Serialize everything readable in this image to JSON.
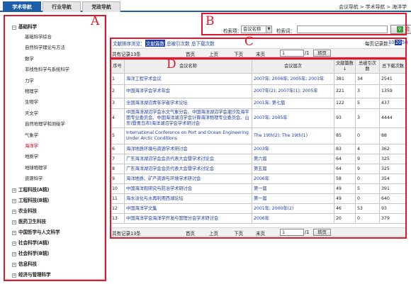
{
  "tabs": [
    "学术导航",
    "行业导航",
    "党政导航"
  ],
  "breadcrumb": "会议导航 > 学术导航 > 海洋学",
  "sidebar": {
    "categories": [
      {
        "label": "基础科学",
        "expanded": true,
        "children": [
          "基础科学综合",
          "自然科学理论与方法",
          "数学",
          "非线性科学与系统科学",
          "力学",
          "物理学",
          "生物学",
          "天文学",
          "自然地理学和测绘学",
          "气象学",
          "海洋学",
          "地质学",
          "地球物理学",
          "资源科学"
        ]
      },
      {
        "label": "工程科技(A辑)",
        "expanded": false
      },
      {
        "label": "工程科技(B辑)",
        "expanded": false
      },
      {
        "label": "农业科技",
        "expanded": false
      },
      {
        "label": "医药卫生科技",
        "expanded": false
      },
      {
        "label": "中国哲学与人文科学",
        "expanded": false
      },
      {
        "label": "社会科学(A辑)",
        "expanded": false
      },
      {
        "label": "社会科学(B辑)",
        "expanded": false
      },
      {
        "label": "信息科技",
        "expanded": false
      },
      {
        "label": "经济与管理科学",
        "expanded": false
      }
    ],
    "selected": "海洋学",
    "expand_glyph": "+",
    "collapse_glyph": "−"
  },
  "search": {
    "field_label": "检索项：",
    "field_value": "会议名称",
    "field_arrow": "▼",
    "word_label": "检索词：",
    "word_value": "",
    "button_label": "检 索",
    "button_icon": "magnifier-icon"
  },
  "order": {
    "label": "文献排序浏览：",
    "options": [
      "文献篇数",
      "总被引次数",
      "总下载次数"
    ],
    "active": 0,
    "per_page_label": "每页记录数：",
    "per_page_options": [
      "10",
      "20",
      "50"
    ],
    "per_page_active": 1
  },
  "pager": {
    "total": "共有记录13条",
    "first": "首页",
    "prev": "上页",
    "next": "下页",
    "last": "末页",
    "page_value": "1",
    "page_unit": "/1",
    "go": "转页"
  },
  "table": {
    "headers": [
      "序号",
      "会议名称",
      "会议届次",
      "文献篇数↓",
      "总被引次数",
      "总下载次数"
    ],
    "rows": [
      [
        "1",
        "海洋工程学术会议",
        "2007年; 2006年; 2005年; 2003年",
        "381",
        "34",
        "2541"
      ],
      [
        "2",
        "中国海洋学会学术年会",
        "2007年(2); 2007年(1); 2005年",
        "221",
        "3",
        "1359"
      ],
      [
        "3",
        "全国海洋湖沼青年学者学术论坛",
        "2001年; 第七届",
        "122",
        "5",
        "437"
      ],
      [
        "4",
        "中国海洋湖沼学会水文气象分会、中国海洋湖沼学会潮汐及海平面专业委员会、中国海洋湖沼学会计算海洋物理专业委员会、山东(暨青岛市)海洋湖沼学会学术研讨会",
        "2007年; 2005年",
        "93",
        "3",
        "4444"
      ],
      [
        "5",
        "International Conference on Port and Ocean Engineering Under Arctic Conditions",
        "The 19th(2); The 19th(1)",
        "85",
        "0",
        "88"
      ],
      [
        "6",
        "海洋地质环境与资源学术研讨会",
        "2003年",
        "83",
        "4",
        "362"
      ],
      [
        "7",
        "广东海洋湖沼学会会员代表大会暨学术讨论会",
        "第六届",
        "64",
        "9",
        "325"
      ],
      [
        "8",
        "广东海洋湖沼学会会员代表大会暨学术讨论会",
        "第五届",
        "64",
        "9",
        "325"
      ],
      [
        "9",
        "海洋地质、矿产资源与环境学术研讨会",
        "2006年",
        "58",
        "0",
        "354"
      ],
      [
        "10",
        "中国海洋观研究与防治学术研讨会",
        "第一届",
        "49",
        "5",
        "391"
      ],
      [
        "11",
        "海水淡化与水再利用西湖论坛",
        "第一届",
        "49",
        "0",
        "640"
      ],
      [
        "12",
        "中国海洋学文集",
        "2001年; 2000年(2)",
        "46",
        "53",
        "93"
      ],
      [
        "13",
        "中国海洋学会海洋学开发与管理分会学术研讨会",
        "2006年",
        "20",
        "0",
        "379"
      ]
    ]
  },
  "annotations": [
    "A",
    "B",
    "C",
    "D"
  ],
  "colors": {
    "accent": "#1f5ea8",
    "annotation": "#e0182c",
    "link": "#1f3fa8",
    "selected": "#d8001a"
  }
}
